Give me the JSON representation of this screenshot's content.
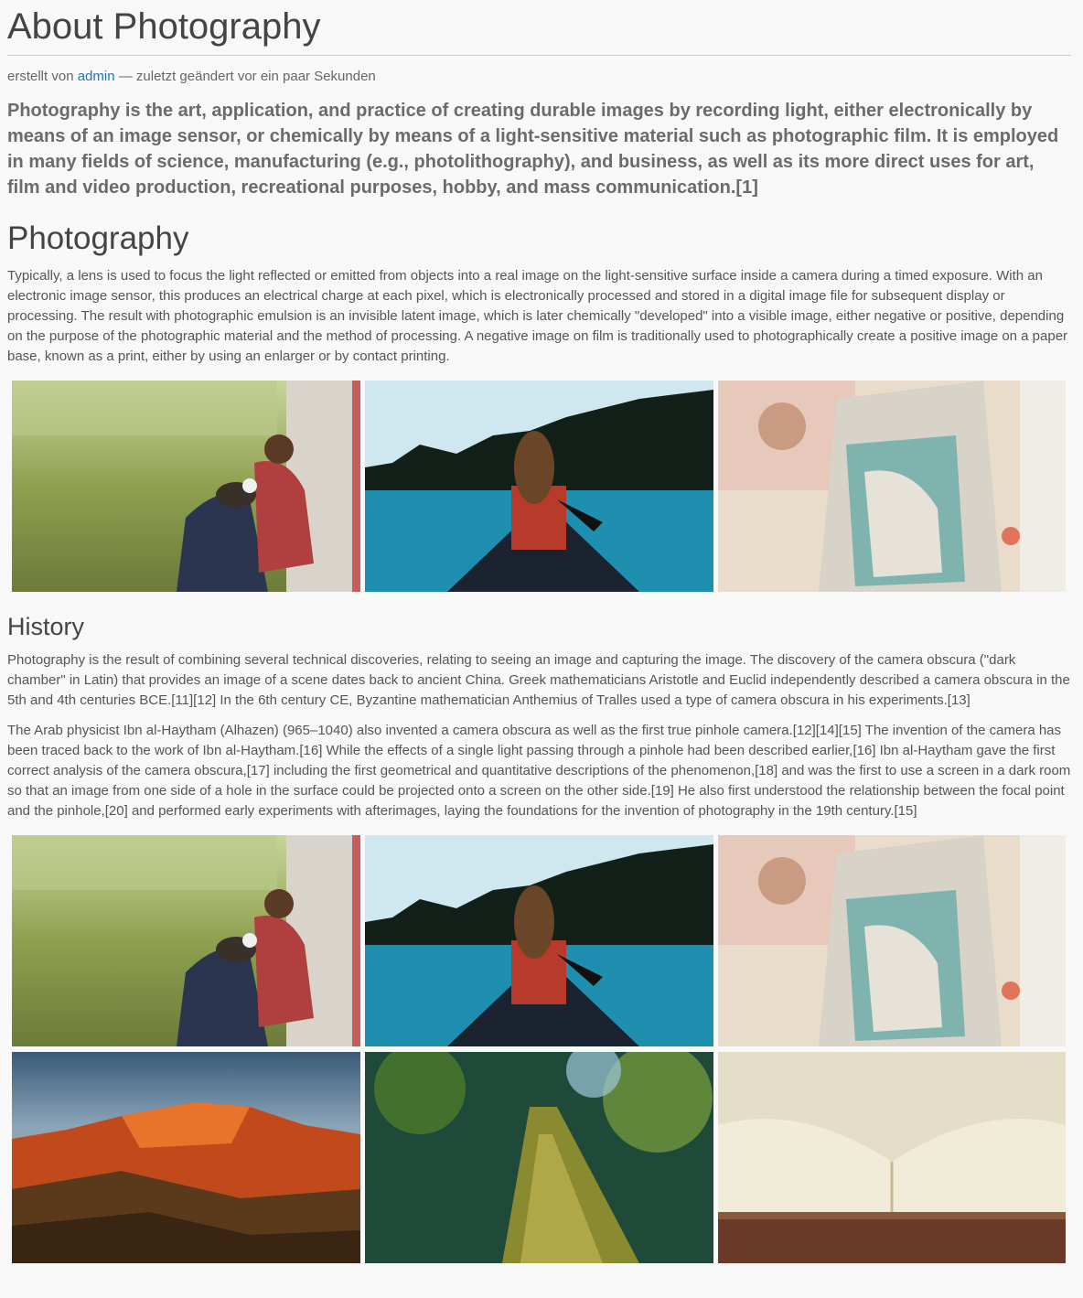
{
  "page": {
    "title": "About Photography",
    "byline": {
      "prefix": "erstellt von",
      "author": "admin",
      "suffix": "— zuletzt geändert vor ein paar Sekunden"
    },
    "lead": "Photography is the art, application, and practice of creating durable images by recording light, either electronically by means of an image sensor, or chemically by means of a light-sensitive material such as photographic film. It is employed in many fields of science, manufacturing (e.g., photolithography), and business, as well as its more direct uses for art, film and video production, recreational purposes, hobby, and mass communication.[1]"
  },
  "sections": {
    "photography": {
      "heading": "Photography",
      "paragraph": "Typically, a lens is used to focus the light reflected or emitted from objects into a real image on the light-sensitive surface inside a camera during a timed exposure. With an electronic image sensor, this produces an electrical charge at each pixel, which is electronically processed and stored in a digital image file for subsequent display or processing. The result with photographic emulsion is an invisible latent image, which is later chemically \"developed\" into a visible image, either negative or positive, depending on the purpose of the photographic material and the method of processing. A negative image on film is traditionally used to photographically create a positive image on a paper base, known as a print, either by using an enlarger or by contact printing."
    },
    "history": {
      "heading": "History",
      "paragraph1": "Photography is the result of combining several technical discoveries, relating to seeing an image and capturing the image. The discovery of the camera obscura (\"dark chamber\" in Latin) that provides an image of a scene dates back to ancient China. Greek mathematicians Aristotle and Euclid independently described a camera obscura in the 5th and 4th centuries BCE.[11][12] In the 6th century CE, Byzantine mathematician Anthemius of Tralles used a type of camera obscura in his experiments.[13]",
      "paragraph2": "The Arab physicist Ibn al-Haytham (Alhazen) (965–1040) also invented a camera obscura as well as the first true pinhole camera.[12][14][15] The invention of the camera has been traced back to the work of Ibn al-Haytham.[16] While the effects of a single light passing through a pinhole had been described earlier,[16] Ibn al-Haytham gave the first correct analysis of the camera obscura,[17] including the first geometrical and quantitative descriptions of the phenomenon,[18] and was the first to use a screen in a dark room so that an image from one side of a hole in the surface could be projected onto a screen on the other side.[19] He also first understood the relationship between the focal point and the pinhole,[20] and performed early experiments with afterimages, laying the foundations for the invention of photography in the 19th century.[15]"
    }
  },
  "colors": {
    "link": "#1a7ab8",
    "background": "#f8f8f8",
    "heading": "#444444",
    "text": "#555555"
  },
  "images": {
    "man_with_dog": "man-with-dog-in-grass-photo",
    "canoe_lake": "woman-in-canoe-on-lake-photo",
    "car_window": "woman-in-vintage-car-photo",
    "red_rocks": "red-rock-canyon-photo",
    "mossy_tree": "moss-covered-tree-trunk-photo",
    "open_book": "open-book-photo"
  }
}
